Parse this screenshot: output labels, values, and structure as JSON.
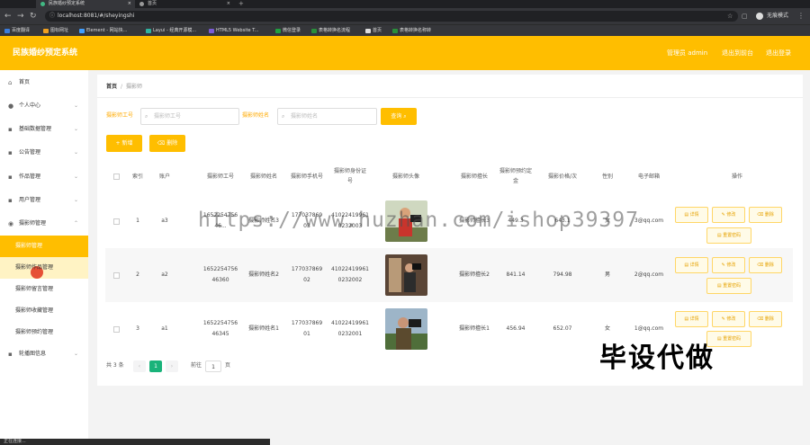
{
  "browser": {
    "tabs": [
      {
        "title": "民族婚纱预定系统",
        "active": true
      },
      {
        "title": "首页",
        "active": false
      }
    ],
    "url": "localhost:8081/#/sheyingshi",
    "profile": "无痕模式",
    "bookmarks": [
      "百度翻译",
      "图标网址",
      "Element - 网站快...",
      "Layui - 经典开源模...",
      "HTML5 Website T...",
      "微信登录",
      "表格转换名流程",
      "首页",
      "表格转换名称转"
    ]
  },
  "header": {
    "brand": "民族婚纱预定系统",
    "links": [
      "管理员 admin",
      "退出到前台",
      "退出登录"
    ]
  },
  "sidebar": {
    "items": [
      {
        "label": "首页",
        "icon": "home-icon"
      },
      {
        "label": "个人中心",
        "icon": "user-icon"
      },
      {
        "label": "基础数据管理",
        "icon": "grid-icon"
      },
      {
        "label": "公告管理",
        "icon": "notice-icon"
      },
      {
        "label": "作品管理",
        "icon": "image-icon"
      },
      {
        "label": "用户管理",
        "icon": "users-icon"
      },
      {
        "label": "摄影师管理",
        "icon": "camera-icon"
      }
    ],
    "subitems": [
      "摄影师管理",
      "摄影师作品管理",
      "摄影师留言管理",
      "摄影师收藏管理",
      "摄影师预约管理"
    ],
    "last": {
      "label": "轮播图信息",
      "icon": "carousel-icon"
    }
  },
  "breadcrumb": {
    "home": "首页",
    "sep": "/",
    "current": "摄影师"
  },
  "filters": {
    "field1_label": "摄影师工号",
    "field1_placeholder": "摄影师工号",
    "field2_label": "摄影师姓名",
    "field2_placeholder": "摄影师姓名",
    "query_button": "查询"
  },
  "actions": {
    "add": "新增",
    "delete": "删除"
  },
  "table": {
    "headers": [
      "索引",
      "账户",
      "摄影师工号",
      "摄影师姓名",
      "摄影师手机号",
      "摄影师身份证号",
      "摄影师头像",
      "摄影师擅长",
      "摄影师预约定金",
      "摄影价格/次",
      "性别",
      "电子邮箱",
      "操作"
    ],
    "rows": [
      {
        "index": "1",
        "account": "a3",
        "id": "165225475646...",
        "name": "摄影师姓名3",
        "phone": "17703786903",
        "idcard": "410224199610232003",
        "specialty": "摄影师擅长3",
        "deposit": "449.3",
        "price": "643.1",
        "gender": "女",
        "email": "3@qq.com"
      },
      {
        "index": "2",
        "account": "a2",
        "id": "165225475646360",
        "name": "摄影师姓名2",
        "phone": "17703786902",
        "idcard": "410224199610232002",
        "specialty": "摄影师擅长2",
        "deposit": "841.14",
        "price": "794.98",
        "gender": "男",
        "email": "2@qq.com"
      },
      {
        "index": "3",
        "account": "a1",
        "id": "165225475646345",
        "name": "摄影师姓名1",
        "phone": "17703786901",
        "idcard": "410224199610232001",
        "specialty": "摄影师擅长1",
        "deposit": "456.94",
        "price": "652.07",
        "gender": "女",
        "email": "1@qq.com"
      }
    ],
    "row_buttons": {
      "detail": "详情",
      "edit": "修改",
      "delete": "删除",
      "reset": "重置密码"
    }
  },
  "pager": {
    "total": "共 3 条",
    "page": "1",
    "goto": "前往",
    "goto_value": "1",
    "unit": "页"
  },
  "overlay": {
    "watermark": "https://www.huzhan.com/ishop39397",
    "promo": "毕设代做"
  },
  "statusbar": "正在连接..."
}
